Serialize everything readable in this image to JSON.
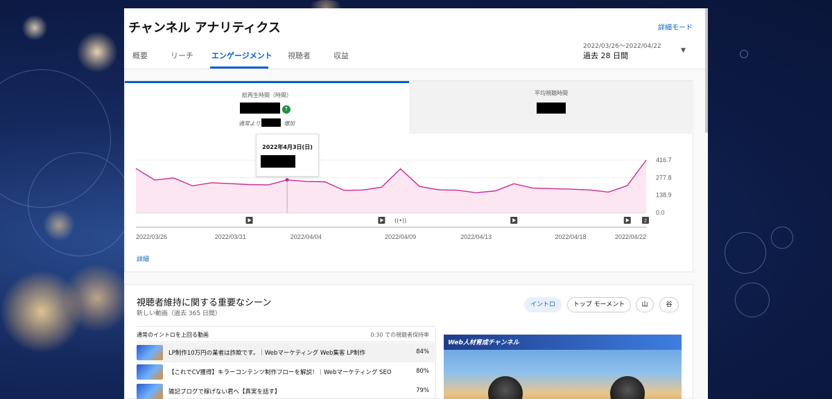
{
  "header": {
    "title": "チャンネル アナリティクス",
    "detail_mode": "詳細モード",
    "date_range": "2022/03/26〜2022/04/22",
    "date_label": "過去 28 日間",
    "tabs": [
      {
        "label": "概要"
      },
      {
        "label": "リーチ"
      },
      {
        "label": "エンゲージメント"
      },
      {
        "label": "視聴者"
      },
      {
        "label": "収益"
      }
    ]
  },
  "metrics": {
    "total_watch_time_label": "総再生時間（時間）",
    "note_prefix": "通常より",
    "note_suffix": "増加",
    "avg_view_duration_label": "平均視聴時間"
  },
  "tooltip": {
    "date": "2022年4月3日(日)"
  },
  "detail_link": "詳細",
  "chart_data": {
    "type": "area",
    "x": [
      "2022/03/26",
      "2022/03/27",
      "2022/03/28",
      "2022/03/29",
      "2022/03/30",
      "2022/03/31",
      "2022/04/01",
      "2022/04/02",
      "2022/04/03",
      "2022/04/04",
      "2022/04/05",
      "2022/04/06",
      "2022/04/07",
      "2022/04/08",
      "2022/04/09",
      "2022/04/10",
      "2022/04/11",
      "2022/04/12",
      "2022/04/13",
      "2022/04/14",
      "2022/04/15",
      "2022/04/16",
      "2022/04/17",
      "2022/04/18",
      "2022/04/19",
      "2022/04/20",
      "2022/04/21",
      "2022/04/22"
    ],
    "series": [
      {
        "values": [
          350,
          258,
          275,
          212,
          237,
          230,
          222,
          220,
          260,
          247,
          244,
          177,
          179,
          202,
          347,
          208,
          181,
          178,
          158,
          172,
          229,
          195,
          190,
          186,
          180,
          163,
          214,
          416
        ]
      }
    ],
    "x_tick_labels": [
      "2022/03/26",
      "2022/03/31",
      "2022/04/04",
      "2022/04/09",
      "2022/04/13",
      "2022/04/18",
      "2022/04/22"
    ],
    "x_tick_indices": [
      0,
      5,
      9,
      14,
      18,
      23,
      27
    ],
    "y_ticks": [
      "0.0",
      "138.9",
      "277.8",
      "416.7"
    ],
    "ylim": [
      0,
      416.7
    ],
    "highlight_index": 8,
    "video_marker_indices": [
      6,
      13,
      20,
      26
    ],
    "live_marker_index": 14,
    "marker_count_badge": "2",
    "line_color": "#cc2a8f",
    "fill_color": "#fbe6f1"
  },
  "retention": {
    "title": "視聴者維持に関する重要なシーン",
    "subtitle": "新しい動画（過去 365 日間）",
    "chips": [
      {
        "label": "イントロ"
      },
      {
        "label": "トップ モーメント"
      },
      {
        "label": "山"
      },
      {
        "label": "谷"
      }
    ],
    "table_header_left": "通常のイントロを上回る動画",
    "table_header_right": "0:30 での視聴者保持率",
    "rows": [
      {
        "title": "LP制作10万円の業者は詐欺です。｜Webマーケティング Web集客 LP制作",
        "pct": "84%"
      },
      {
        "title": "【これでCV獲得】キラーコンテンツ制作フローを解説！｜Webマーケティング SEO",
        "pct": "80%"
      },
      {
        "title": "雑記ブログで稼げない君へ【真実を話す】",
        "pct": "79%"
      }
    ],
    "preview_title": "Web人材育成チャンネル"
  },
  "colors": {
    "accent": "#065fd4",
    "up": "#1e8e3e"
  }
}
